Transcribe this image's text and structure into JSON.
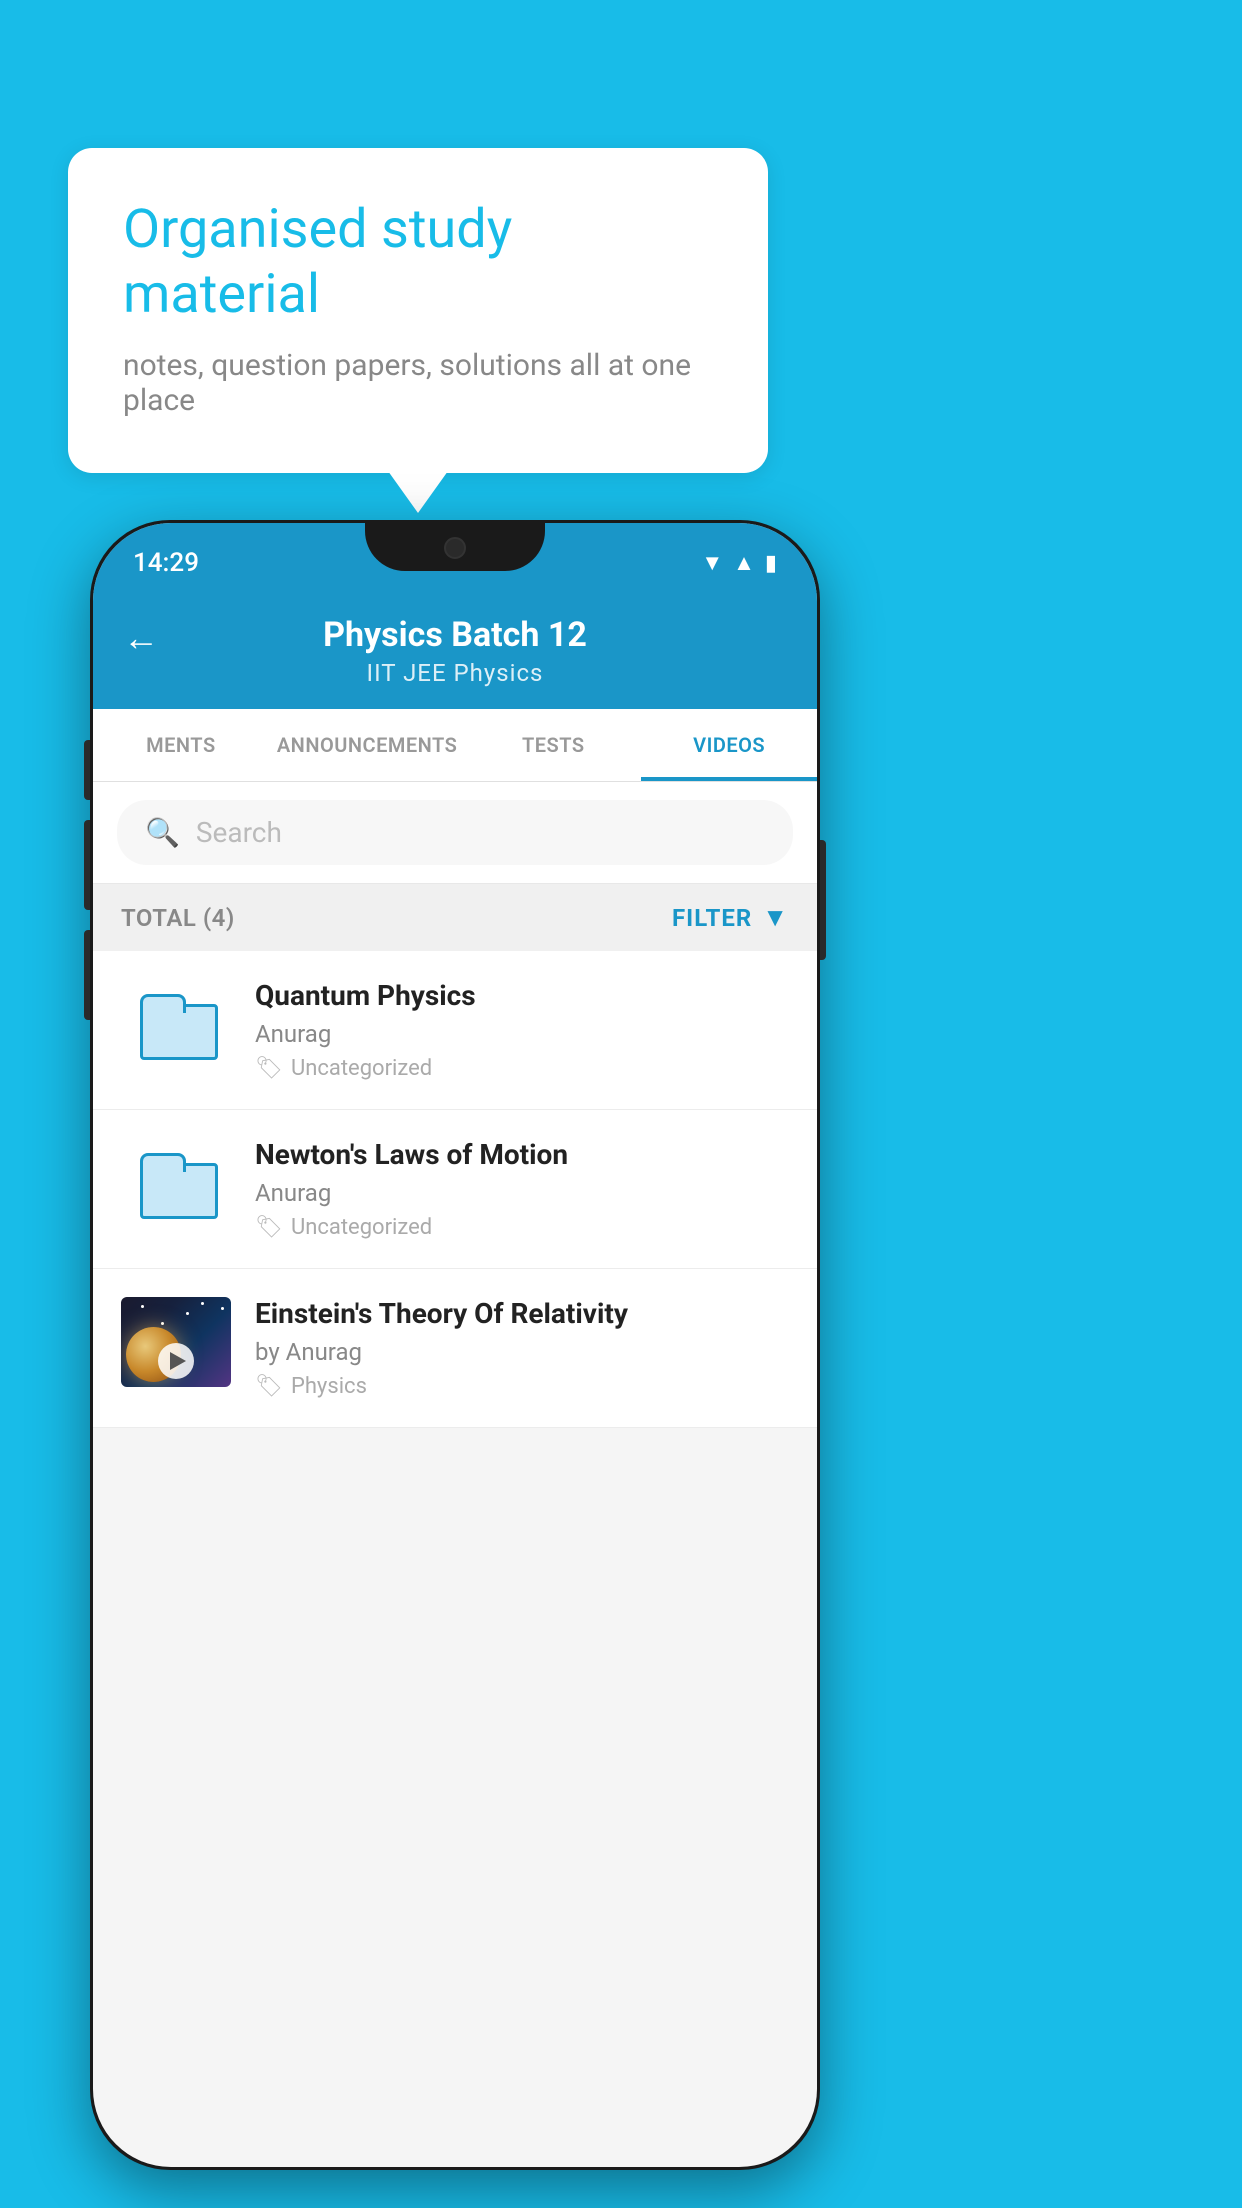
{
  "background_color": "#18bce8",
  "bubble": {
    "title": "Organised study material",
    "subtitle": "notes, question papers, solutions all at one place"
  },
  "status_bar": {
    "time": "14:29",
    "wifi": "▼",
    "signal": "▲",
    "battery": "▮"
  },
  "header": {
    "back_icon": "←",
    "title": "Physics Batch 12",
    "subtitle": "IIT JEE   Physics"
  },
  "tabs": [
    {
      "label": "MENTS",
      "active": false
    },
    {
      "label": "ANNOUNCEMENTS",
      "active": false
    },
    {
      "label": "TESTS",
      "active": false
    },
    {
      "label": "VIDEOS",
      "active": true
    }
  ],
  "search": {
    "placeholder": "Search"
  },
  "filter_bar": {
    "total": "TOTAL (4)",
    "filter_label": "FILTER"
  },
  "videos": [
    {
      "title": "Quantum Physics",
      "author": "Anurag",
      "tag": "Uncategorized",
      "type": "folder"
    },
    {
      "title": "Newton's Laws of Motion",
      "author": "Anurag",
      "tag": "Uncategorized",
      "type": "folder"
    },
    {
      "title": "Einstein's Theory Of Relativity",
      "author": "by Anurag",
      "tag": "Physics",
      "type": "video"
    }
  ]
}
